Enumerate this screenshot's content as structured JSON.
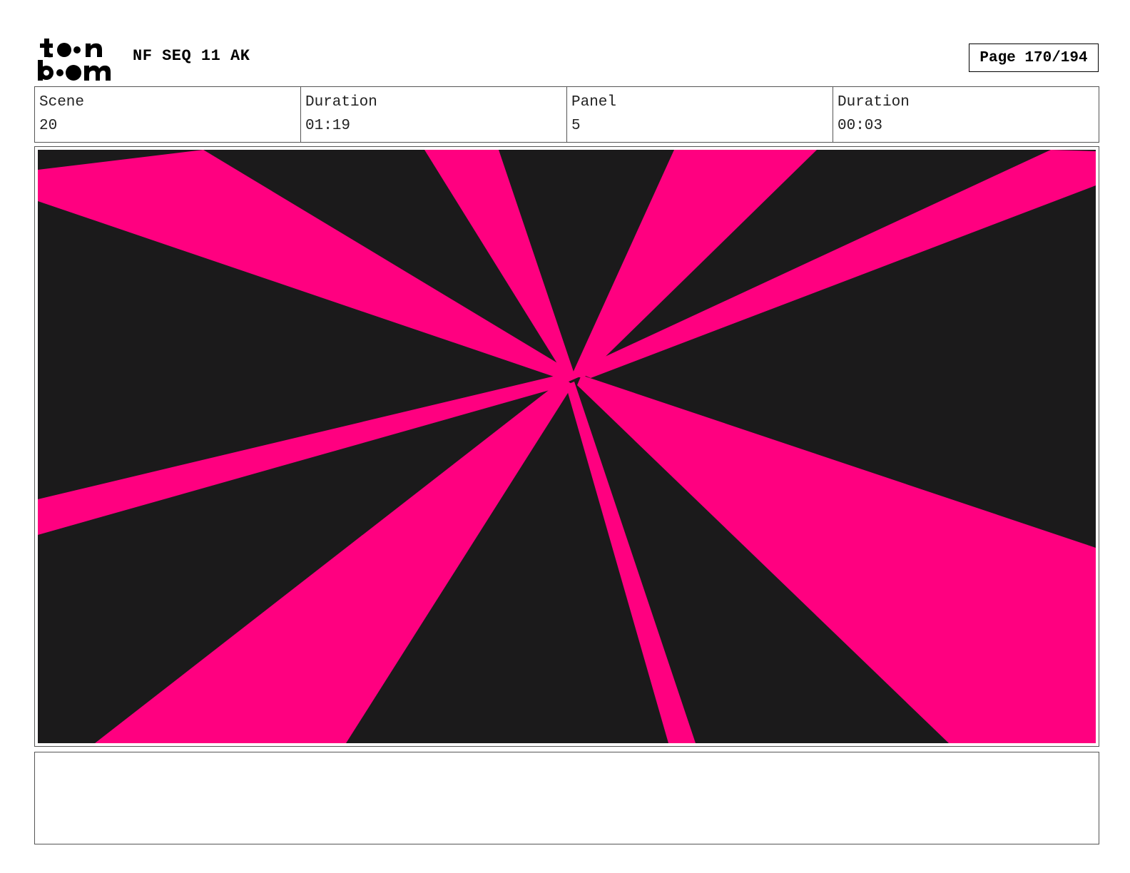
{
  "header": {
    "logo_text": "toon boom",
    "document_title": "NF SEQ 11 AK",
    "page_indicator": "Page 170/194"
  },
  "info": {
    "scene_label": "Scene",
    "scene_value": "20",
    "scene_duration_label": "Duration",
    "scene_duration_value": "01:19",
    "panel_label": "Panel",
    "panel_value": "5",
    "panel_duration_label": "Duration",
    "panel_duration_value": "00:03"
  },
  "panel_art": {
    "description_icon": "radial-burst-image",
    "background_color": "#1b1a1b",
    "ray_color": "#ff0080"
  },
  "notes": {
    "text": ""
  }
}
